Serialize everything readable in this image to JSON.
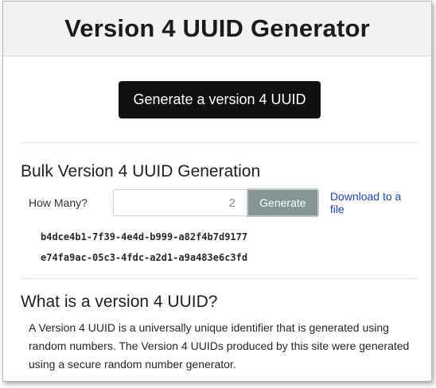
{
  "header": {
    "title": "Version 4 UUID Generator"
  },
  "primary": {
    "button_label": "Generate a version 4 UUID"
  },
  "bulk": {
    "heading": "Bulk Version 4 UUID Generation",
    "how_many_label": "How Many?",
    "count_value": "2",
    "generate_label": "Generate",
    "download_label": "Download to a file",
    "uuids": [
      "b4dce4b1-7f39-4e4d-b999-a82f4b7d9177",
      "e74fa9ac-05c3-4fdc-a2d1-a9a483e6c3fd"
    ]
  },
  "about": {
    "heading": "What is a version 4 UUID?",
    "text": "A Version 4 UUID is a universally unique identifier that is generated using random numbers. The Version 4 UUIDs produced by this site were generated using a secure random number generator."
  },
  "colors": {
    "primary_button": "#111111",
    "generate_button": "#849596",
    "link": "#1a3fd6",
    "header_bg": "#f2f2f2"
  }
}
